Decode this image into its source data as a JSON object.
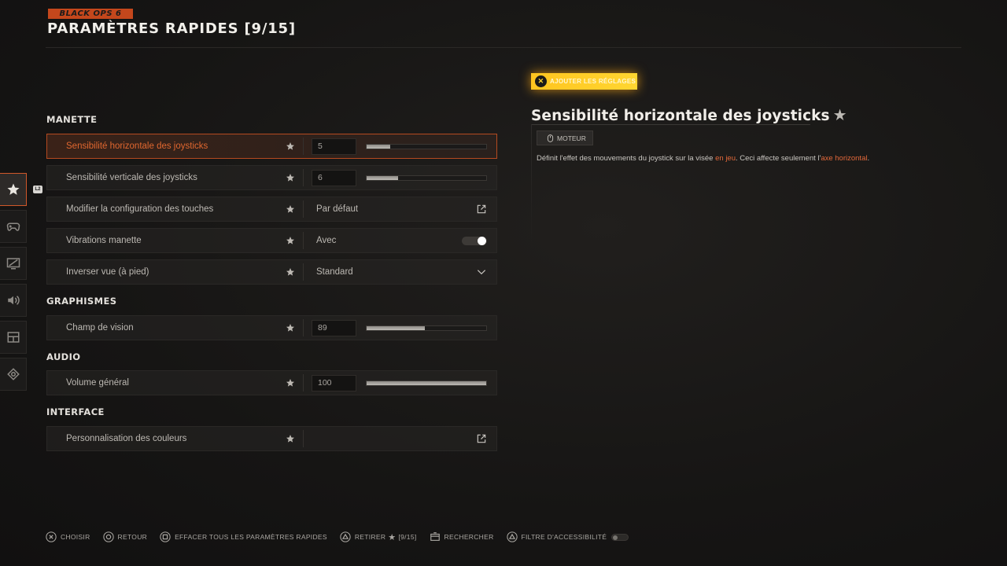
{
  "header": {
    "logo_text": "BLACK OPS 6",
    "title": "PARAMÈTRES RAPIDES [9/15]"
  },
  "sidebar": {
    "items": [
      {
        "icon": "star-icon",
        "active": true
      },
      {
        "icon": "gamepad-icon",
        "active": false
      },
      {
        "icon": "display-icon",
        "active": false
      },
      {
        "icon": "speaker-icon",
        "active": false
      },
      {
        "icon": "interface-icon",
        "active": false
      },
      {
        "icon": "network-icon",
        "active": false
      }
    ],
    "tab_hint": "L2"
  },
  "sections": {
    "manette": "MANETTE",
    "graphismes": "GRAPHISMES",
    "audio": "AUDIO",
    "interface": "INTERFACE"
  },
  "settings": {
    "horiz_sens": {
      "label": "Sensibilité horizontale des joysticks",
      "value": "5",
      "slider_fraction": 0.2
    },
    "vert_sens": {
      "label": "Sensibilité verticale des joysticks",
      "value": "6",
      "slider_fraction": 0.26
    },
    "button_layout": {
      "label": "Modifier la configuration des touches",
      "value": "Par défaut"
    },
    "vibration": {
      "label": "Vibrations manette",
      "value": "Avec",
      "enabled": true
    },
    "invert_view": {
      "label": "Inverser vue (à pied)",
      "value": "Standard"
    },
    "fov": {
      "label": "Champ de vision",
      "value": "89",
      "slider_fraction": 0.49
    },
    "master_volume": {
      "label": "Volume général",
      "value": "100",
      "slider_fraction": 1.0
    },
    "color_custom": {
      "label": "Personnalisation des couleurs"
    }
  },
  "detail": {
    "badge_text": "AJOUTER LES RÉGLAGES",
    "title": "Sensibilité horizontale des joysticks",
    "tag": "MOTEUR",
    "desc_part1": "Définit l'effet des mouvements du joystick sur la visée ",
    "desc_hl1": "en jeu",
    "desc_part2": ". Ceci affecte seulement l'",
    "desc_hl2": "axe horizontal",
    "desc_part3": "."
  },
  "footer": {
    "choose": "CHOISIR",
    "back": "RETOUR",
    "clear_all": "EFFACER TOUS LES PARAMÈTRES RAPIDES",
    "remove": "RETIRER",
    "remove_count": "[9/15]",
    "search": "RECHERCHER",
    "accessibility": "FILTRE D'ACCESSIBILITÉ"
  },
  "colors": {
    "accent": "#e0672f",
    "highlight_border": "#b54a20",
    "badge": "#ffc51f"
  }
}
